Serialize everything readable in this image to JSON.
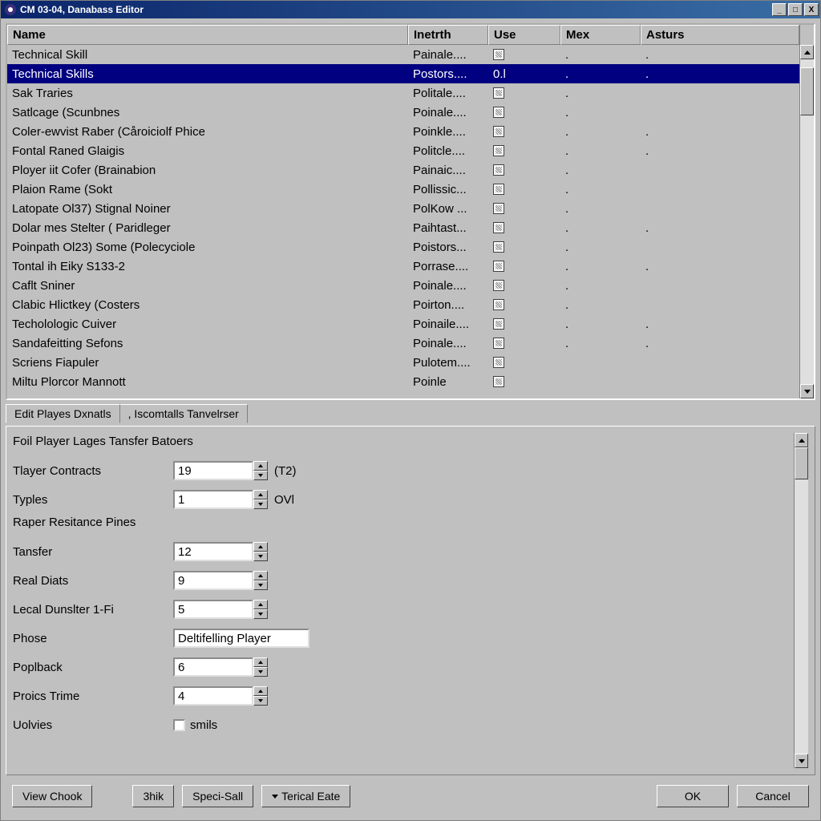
{
  "window": {
    "title": "CM 03-04, Danabass Editor"
  },
  "columns": {
    "c0": "Name",
    "c1": "Inetrth",
    "c2": "Use",
    "c3": "Mex",
    "c4": "Asturs"
  },
  "rows": [
    {
      "name": "Technical Skill",
      "inetrth": "Painale....",
      "use": "box",
      "mex": ".",
      "ast": "."
    },
    {
      "name": "Technical Skills",
      "inetrth": "Postors....",
      "use": "0.l",
      "mex": ".",
      "ast": ".",
      "selected": true
    },
    {
      "name": "Sak Traries",
      "inetrth": "Politale....",
      "use": "box",
      "mex": ".",
      "ast": ""
    },
    {
      "name": "Satlcage (Scunbnes",
      "inetrth": "Poinale....",
      "use": "box",
      "mex": ".",
      "ast": ""
    },
    {
      "name": "Coler-ewvist Raber (Cåroiciolf Phice",
      "inetrth": "Poinkle....",
      "use": "box",
      "mex": ".",
      "ast": "."
    },
    {
      "name": "Fontal Raned Glaigis",
      "inetrth": "Politcle....",
      "use": "box",
      "mex": ".",
      "ast": "."
    },
    {
      "name": "Ployer iit Cofer (Brainabion",
      "inetrth": "Painaic....",
      "use": "box",
      "mex": ".",
      "ast": ""
    },
    {
      "name": "Plaion Rame (Sokt",
      "inetrth": "Pollissic...",
      "use": "box",
      "mex": ".",
      "ast": ""
    },
    {
      "name": "Latopate Ol37) Stignal Noiner",
      "inetrth": "PolKow ...",
      "use": "box",
      "mex": ".",
      "ast": ""
    },
    {
      "name": "Dolar mes Stelter ( Paridleger",
      "inetrth": "Paihtast...",
      "use": "box",
      "mex": ".",
      "ast": "."
    },
    {
      "name": "Poinpath Ol23) Some (Polecyciole",
      "inetrth": "Poistors...",
      "use": "box",
      "mex": ".",
      "ast": ""
    },
    {
      "name": "Tontal ih Eiky S133-2",
      "inetrth": "Porrase....",
      "use": "box",
      "mex": ".",
      "ast": "."
    },
    {
      "name": "Caflt Sniner",
      "inetrth": "Poinale....",
      "use": "box",
      "mex": ".",
      "ast": ""
    },
    {
      "name": "Clabic Hlictkey (Costers",
      "inetrth": "Poirton....",
      "use": "box",
      "mex": ".",
      "ast": ""
    },
    {
      "name": "Techolologic Cuiver",
      "inetrth": "Poinaile....",
      "use": "box",
      "mex": ".",
      "ast": "."
    },
    {
      "name": "Sandafeitting Sefons",
      "inetrth": "Poinale....",
      "use": "box",
      "mex": ".",
      "ast": "."
    },
    {
      "name": "Scriens Fiapuler",
      "inetrth": "Pulotem....",
      "use": "box",
      "mex": "",
      "ast": ""
    },
    {
      "name": "Miltu Plorcor Mannott",
      "inetrth": "Poinle",
      "use": "box",
      "mex": "",
      "ast": ""
    }
  ],
  "tabs": {
    "t0": "Edit Playes Dxnatls",
    "t1": ", Iscomtalls Tanvelrser"
  },
  "form": {
    "title": "Foil Player Lages Tansfer Batoers",
    "contracts_label": "Tlayer Contracts",
    "contracts_value": "19",
    "contracts_suffix": "(T2)",
    "types_label": "Typles",
    "types_value": "1",
    "types_suffix": "OVl",
    "section2": "Raper Resitance Pines",
    "tansfer_label": "Tansfer",
    "tansfer_value": "12",
    "real_label": "Real Diats",
    "real_value": "9",
    "lecal_label": "Lecal Dunslter 1-Fi",
    "lecal_value": "5",
    "phose_label": "Phose",
    "phose_value": "Deltifelling Player",
    "poplback_label": "Poplback",
    "poplback_value": "6",
    "proics_label": "Proics Trime",
    "proics_value": "4",
    "uolvies_label": "Uolvies",
    "uolvies_suffix": "smils"
  },
  "buttons": {
    "view": "View Chook",
    "hik": "3hik",
    "speci": "Speci-Sall",
    "terical": "Terical Eate",
    "ok": "OK",
    "cancel": "Cancel"
  }
}
